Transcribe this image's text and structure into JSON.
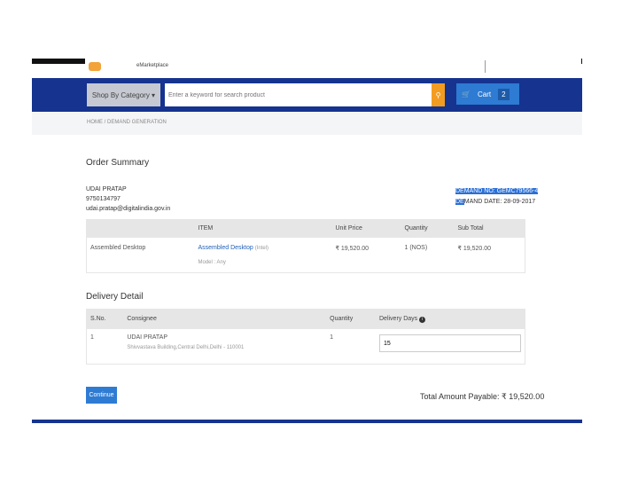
{
  "logo": {
    "subtext": "",
    "mark": "",
    "text": "eMarketplace"
  },
  "nav": {
    "shop_label": "Shop By Category ▾",
    "search_placeholder": "Enter a keyword for search product",
    "cart_label": "Cart",
    "cart_count": "2"
  },
  "breadcrumb": "HOME / DEMAND GENERATION",
  "order": {
    "title": "Order Summary",
    "buyer_name": "UDAI PRATAP",
    "buyer_phone": "9750134797",
    "buyer_email": "udai.pratap@digitalindia.gov.in",
    "demand_no": "DEMAND NO: GEMC79566-4",
    "demand_date_hl": "DE",
    "demand_date_rest": "MAND DATE: 28-09-2017",
    "headers": [
      "",
      "ITEM",
      "Unit Price",
      "Quantity",
      "Sub Total"
    ],
    "row": {
      "category": "Assembled Desktop",
      "item": "Assembled Desktop",
      "brand": "(Intel)",
      "model": "Model : Any",
      "unit_price": "₹ 19,520.00",
      "quantity": "1 (NOS)",
      "subtotal": "₹ 19,520.00"
    }
  },
  "delivery": {
    "title": "Delivery Detail",
    "headers": [
      "S.No.",
      "Consignee",
      "Quantity",
      "Delivery Days"
    ],
    "row": {
      "sno": "1",
      "consignee": "UDAI PRATAP",
      "address": "Shivvastava Building,Central Delhi,Delhi - 110001",
      "quantity": "1",
      "days": "15"
    }
  },
  "continue_label": "Continue",
  "total_label": "Total Amount Payable: ₹ 19,520.00"
}
